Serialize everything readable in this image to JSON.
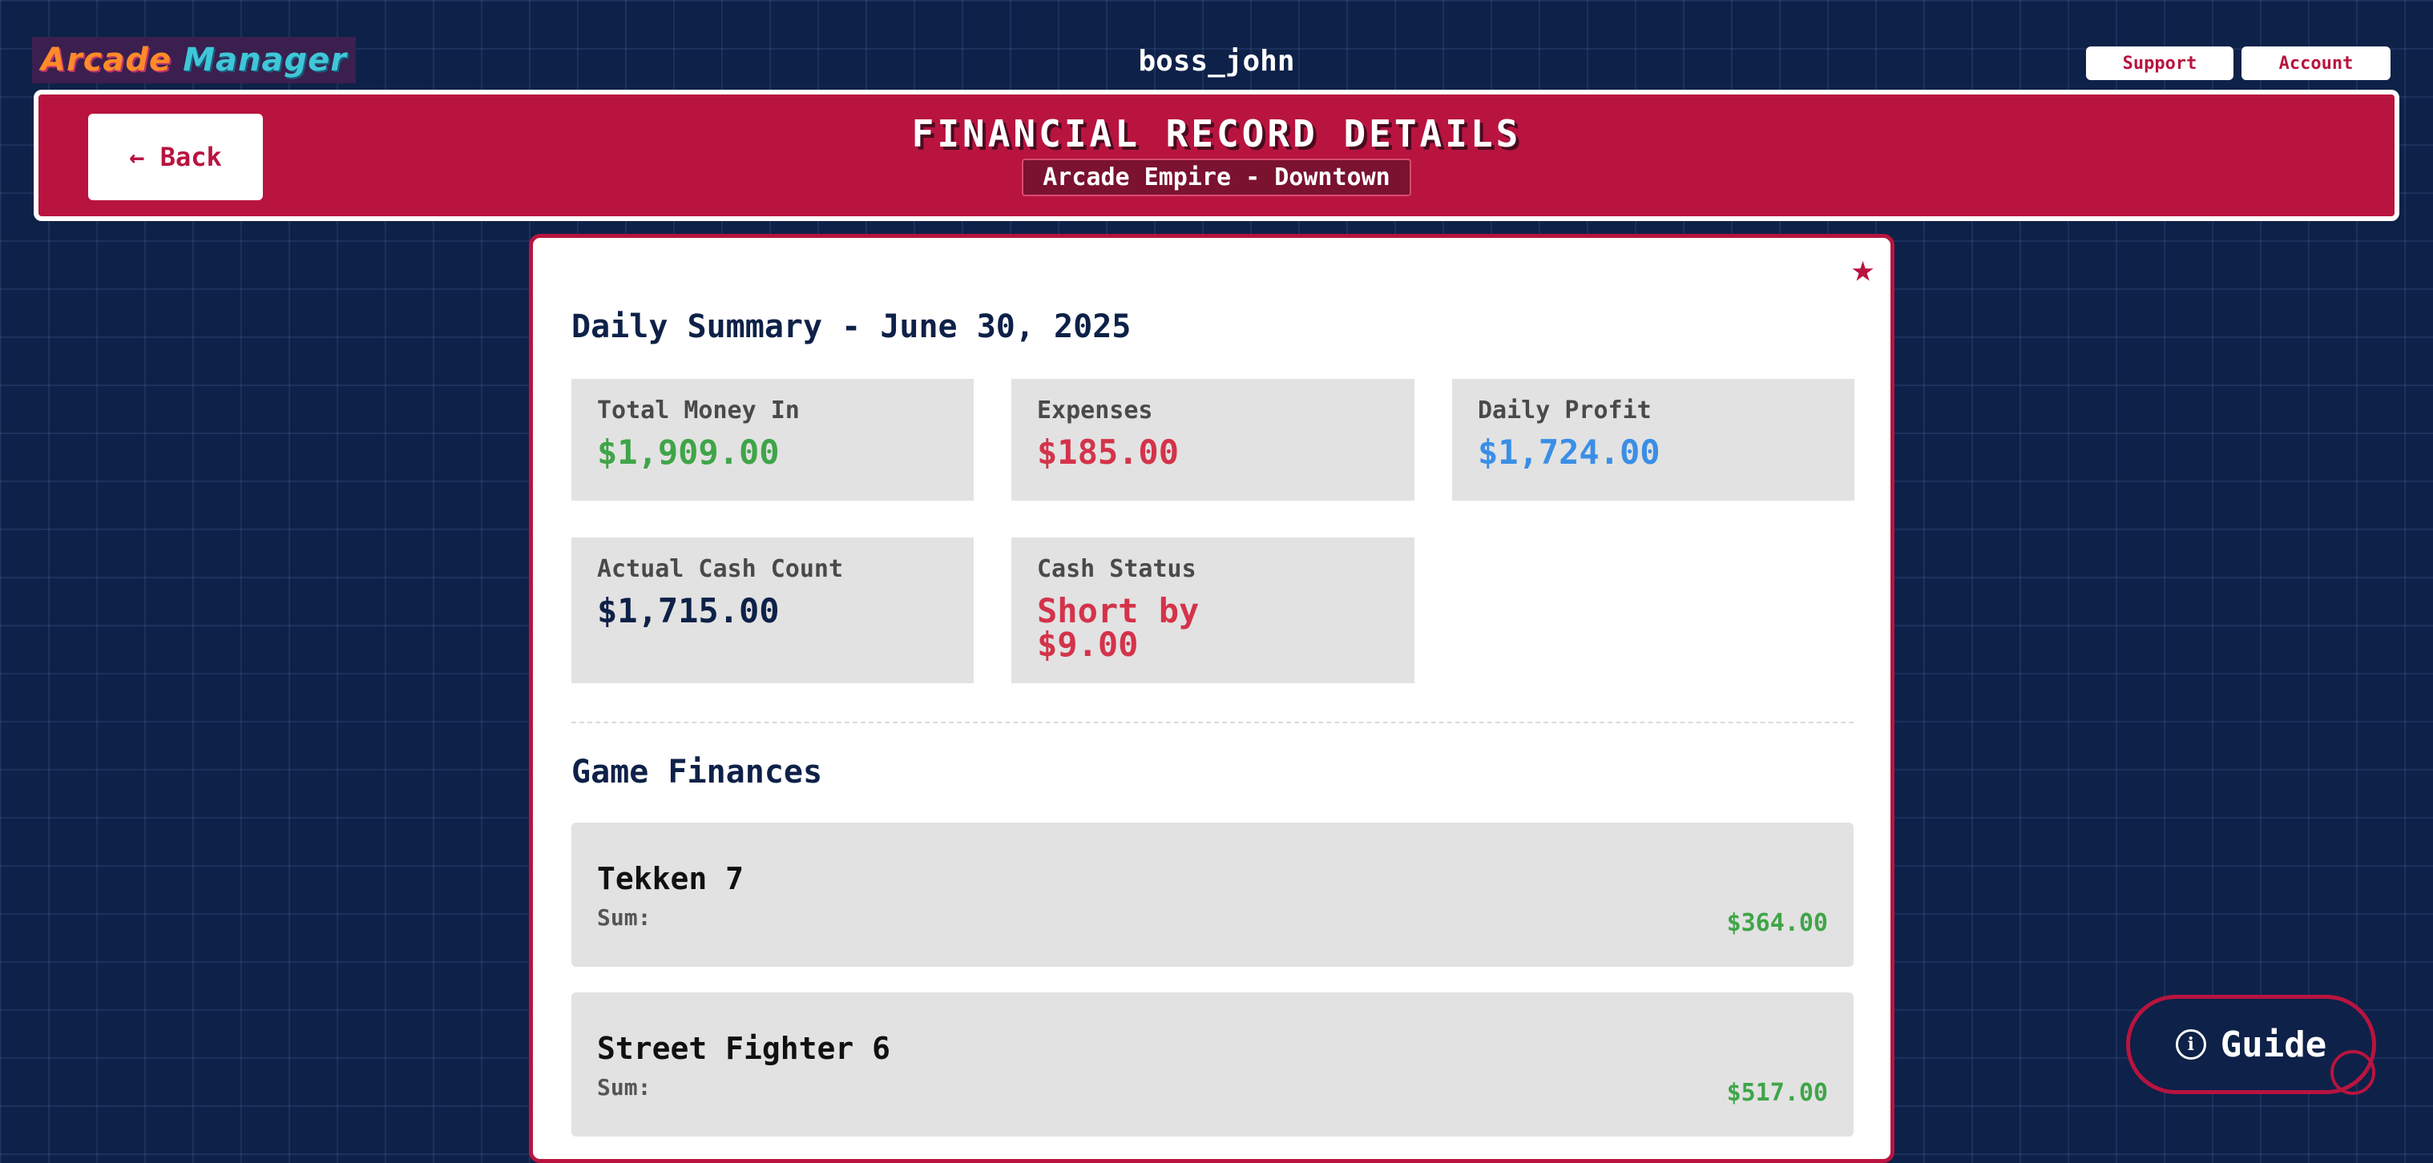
{
  "brand": {
    "part1": "Arcade",
    "part2": "Manager"
  },
  "header": {
    "username": "boss_john",
    "support_label": "Support",
    "account_label": "Account"
  },
  "banner": {
    "back_label": "← Back",
    "title": "FINANCIAL RECORD DETAILS",
    "subtitle": "Arcade Empire - Downtown"
  },
  "summary": {
    "title": "Daily Summary - June 30, 2025",
    "stats": [
      {
        "label": "Total Money In",
        "value": "$1,909.00",
        "color": "#3fa548"
      },
      {
        "label": "Expenses",
        "value": "$185.00",
        "color": "#d4334a"
      },
      {
        "label": "Daily Profit",
        "value": "$1,724.00",
        "color": "#3a8ee6"
      },
      {
        "label": "Actual Cash Count",
        "value": "$1,715.00",
        "color": "#0e2148"
      },
      {
        "label": "Cash Status",
        "value": "Short by $9.00",
        "color": "#d4334a"
      }
    ]
  },
  "games": {
    "title": "Game Finances",
    "items": [
      {
        "name": "Tekken 7",
        "sum_label": "Sum:",
        "sum": "$364.00"
      },
      {
        "name": "Street Fighter 6",
        "sum_label": "Sum:",
        "sum": "$517.00"
      }
    ]
  },
  "guide": {
    "label": "Guide",
    "icon": "info-icon"
  },
  "colors": {
    "accent": "#b8143f",
    "background": "#0e2148",
    "positive": "#3fa548",
    "negative": "#d4334a",
    "profit": "#3a8ee6"
  },
  "favorite_icon": "star-icon"
}
